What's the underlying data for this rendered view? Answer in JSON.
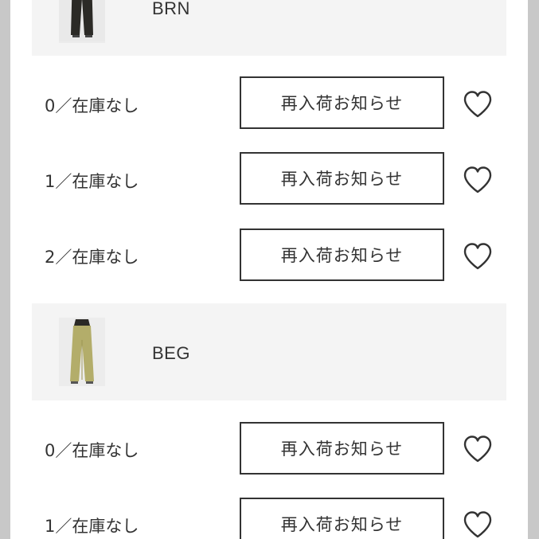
{
  "colors": [
    {
      "code": "BRN"
    },
    {
      "code": "BEG"
    }
  ],
  "rows": [
    {
      "size_status": "0／在庫なし",
      "button_label": "再入荷お知らせ"
    },
    {
      "size_status": "1／在庫なし",
      "button_label": "再入荷お知らせ"
    },
    {
      "size_status": "2／在庫なし",
      "button_label": "再入荷お知らせ"
    },
    {
      "size_status": "0／在庫なし",
      "button_label": "再入荷お知らせ"
    },
    {
      "size_status": "1／在庫なし",
      "button_label": "再入荷お知らせ"
    }
  ],
  "icons": {
    "favorite": "heart-outline-icon",
    "thumbnail": "pants-photo"
  },
  "theme": {
    "page_bg": "#c8c8c8",
    "panel_bg": "#ffffff",
    "header_bg": "#f4f4f4",
    "brn": "#2b2a26",
    "beg": "#b3ad6a"
  }
}
